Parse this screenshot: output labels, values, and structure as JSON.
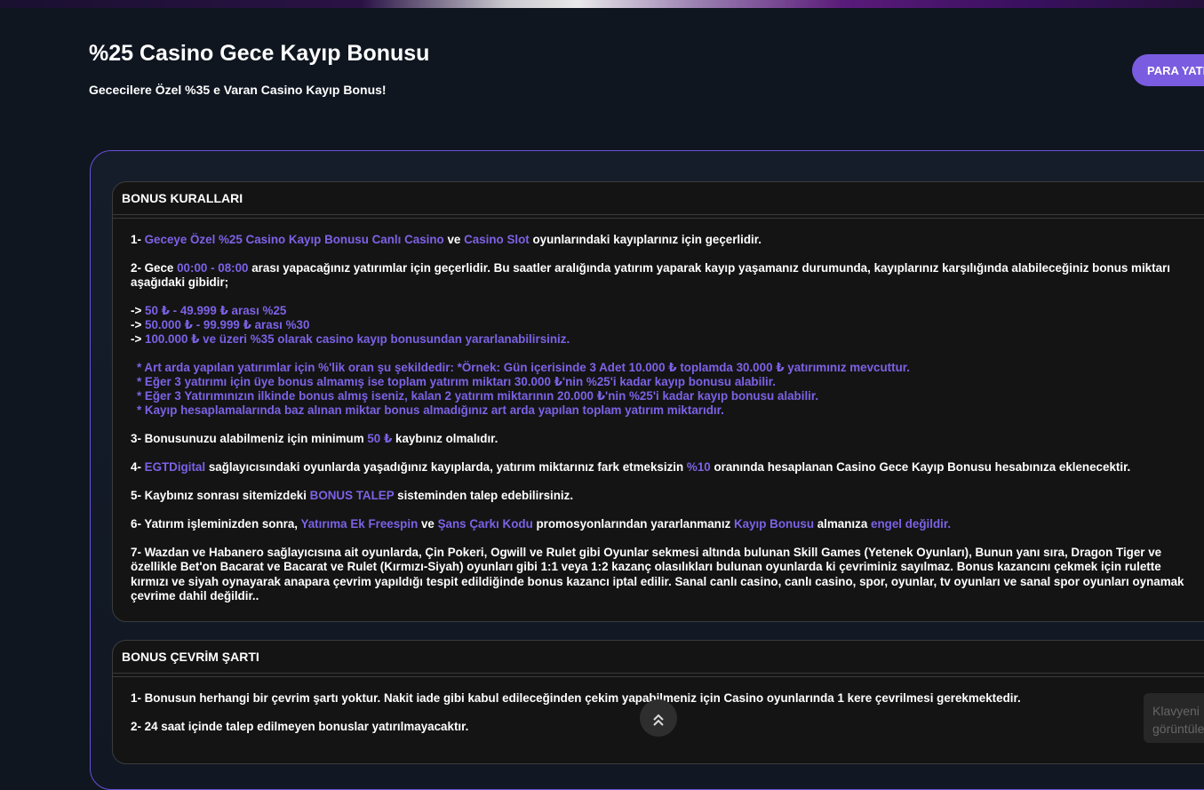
{
  "header": {
    "title": "%25 Casino Gece Kayıp Bonusu",
    "subtitle": "Gececilere Özel %35 e Varan Casino Kayıp Bonus!",
    "deposit_button": "PARA YATIR"
  },
  "rules": {
    "heading": "BONUS KURALLARI",
    "r1": {
      "num": "1- ",
      "hl1": "Geceye Özel %25 Casino Kayıp Bonusu Canlı Casino",
      "t1": " ve ",
      "hl2": "Casino Slot",
      "t2": " oyunlarındaki kayıplarınız için geçerlidir."
    },
    "r2": {
      "num": "2- Gece ",
      "hl1": "00:00 - 08:00",
      "t1": " arası yapacağınız yatırımlar için geçerlidir. Bu saatler aralığında yatırım yaparak kayıp yaşamanız durumunda, kayıplarınız karşılığında alabileceğiniz bonus miktarı aşağıdaki gibidir;"
    },
    "tiers": [
      {
        "arrow": "-> ",
        "text": "50 ₺ - 49.999 ₺ arası %25"
      },
      {
        "arrow": "-> ",
        "text": "50.000 ₺ - 99.999 ₺ arası %30"
      },
      {
        "arrow": "-> ",
        "text": "100.000 ₺ ve üzeri %35 olarak casino kayıp bonusundan yararlanabilirsiniz."
      }
    ],
    "notes": [
      "* Art arda yapılan yatırımlar için %'lik oran şu şekildedir: *Örnek: Gün içerisinde 3 Adet 10.000 ₺ toplamda 30.000 ₺ yatırımınız mevcuttur.",
      "* Eğer 3 yatırımı için üye bonus almamış ise toplam yatırım miktarı 30.000 ₺'nin %25'i kadar kayıp bonusu alabilir.",
      "* Eğer 3 Yatırımınızın ilkinde bonus almış iseniz, kalan 2 yatırım miktarının 20.000 ₺'nin %25'i kadar kayıp bonusu alabilir.",
      "* Kayıp hesaplamalarında baz alınan miktar bonus almadığınız art arda yapılan toplam yatırım miktarıdır."
    ],
    "r3": {
      "num": "3- Bonusunuzu alabilmeniz için minimum ",
      "hl1": "50 ₺",
      "t1": " kaybınız olmalıdır."
    },
    "r4": {
      "num": "4- ",
      "hl1": "EGTDigital",
      "t1": " sağlayıcısındaki oyunlarda yaşadığınız kayıplarda, yatırım miktarınız fark etmeksizin ",
      "hl2": "%10",
      "t2": " oranında hesaplanan Casino Gece Kayıp Bonusu hesabınıza eklenecektir."
    },
    "r5": {
      "num": "5- Kaybınız sonrası sitemizdeki ",
      "hl1": "BONUS TALEP",
      "t1": " sisteminden talep edebilirsiniz."
    },
    "r6": {
      "num": "6- Yatırım işleminizden sonra, ",
      "hl1": "Yatırıma Ek Freespin",
      "t1": " ve ",
      "hl2": "Şans Çarkı Kodu",
      "t2": " promosyonlarından yararlanmanız ",
      "hl3": "Kayıp Bonusu",
      "t3": " almanıza ",
      "hl4": "engel değildir."
    },
    "r7": "7- Wazdan ve Habanero sağlayıcısına ait oyunlarda, Çin Pokeri, Ogwill ve Rulet gibi Oyunlar sekmesi altında bulunan Skill Games (Yetenek Oyunları), Bunun yanı sıra, Dragon Tiger ve özellikle Bet'on Bacarat ve Bacarat ve Rulet (Kırmızı-Siyah) oyunları gibi 1:1 veya 1:2 kazanç olasılıkları bulunan oyunlarda ki çevriminiz sayılmaz. Bonus kazancını çekmek için rulette kırmızı ve siyah oynayarak anapara çevrim yapıldığı tespit edildiğinde bonus kazancı iptal edilir. Sanal canlı casino, canlı casino, spor, oyunlar, tv oyunları ve sanal spor oyunları oynamak çevrime dahil değildir.."
  },
  "wagering": {
    "heading": "BONUS ÇEVRİM ŞARTI",
    "items": [
      "1- Bonusun herhangi bir çevrim şartı yoktur. Nakit iade gibi kabul edileceğinden çekim yapabilmeniz için Casino oyunlarında 1 kere çevrilmesi gerekmektedir.",
      "2- 24 saat içinde talep edilmeyen bonuslar yatırılmayacaktır."
    ]
  },
  "overlay": {
    "scroll_top_icon": "double-chevron-up-icon",
    "scroll_top_glyph": "⌃⌃",
    "keyboard_hint": "Klavyeni görüntüle"
  },
  "colors": {
    "accent": "#7d62e6",
    "button": "#7a5ce0",
    "card_border": "#6b4fd8"
  }
}
